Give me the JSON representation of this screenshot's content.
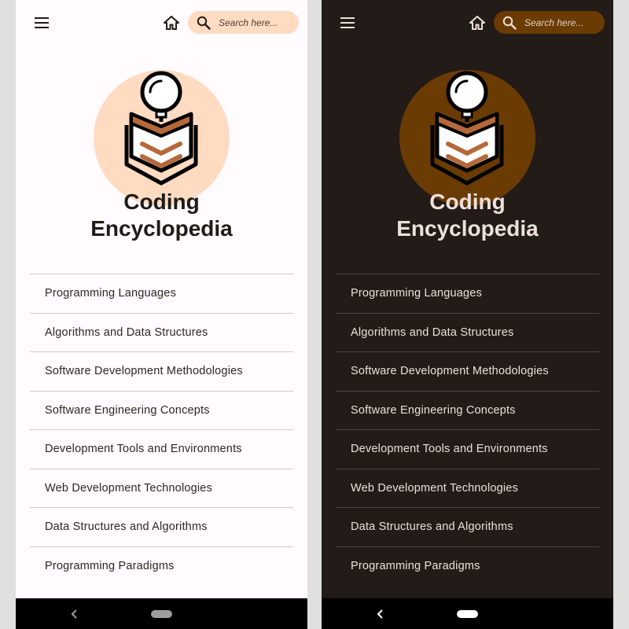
{
  "app": {
    "title_line1": "Coding",
    "title_line2": "Encyclopedia"
  },
  "toolbar": {
    "menu_icon": "hamburger-menu-icon",
    "home_icon": "home-icon",
    "search_icon": "search-icon",
    "search_placeholder": "Search here...",
    "search_value": ""
  },
  "logo": {
    "icon": "encyclopedia-book-magnifier-icon"
  },
  "categories": [
    "Programming Languages",
    "Algorithms and Data Structures",
    "Software Development Methodologies",
    "Software Engineering Concepts",
    "Development Tools and Environments",
    "Web Development Technologies",
    "Data Structures and Algorithms",
    "Programming Paradigms"
  ],
  "system_nav": {
    "back_icon": "back-chevron-icon",
    "home_icon": "home-pill-icon"
  },
  "themes": {
    "light": {
      "background": "#fffbff",
      "accent": "#ffdbc2",
      "text": "#1f1b16",
      "book_accent": "#b5693a"
    },
    "dark": {
      "background": "#221b17",
      "accent": "#6b3b04",
      "text": "#ece0da",
      "book_accent": "#b5693a"
    }
  }
}
